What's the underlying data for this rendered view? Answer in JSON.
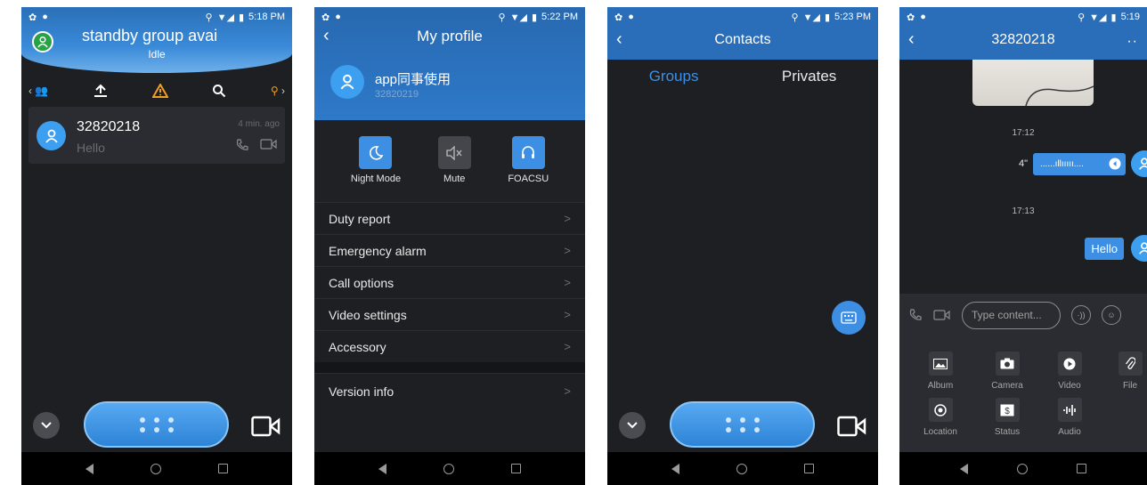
{
  "status_bar": {
    "p1_time": "5:18 PM",
    "p2_time": "5:22 PM",
    "p3_time": "5:23 PM",
    "p4_time": "5:19"
  },
  "standby_screen": {
    "title": "standby group avai",
    "subtitle": "Idle",
    "contact": {
      "name": "32820218",
      "last_message": "Hello",
      "time": "4 min. ago"
    }
  },
  "profile_screen": {
    "title": "My profile",
    "user_name": "app同事使用",
    "user_id": "32820219",
    "quick_actions": [
      {
        "label": "Night Mode"
      },
      {
        "label": "Mute"
      },
      {
        "label": "FOACSU"
      }
    ],
    "menu": [
      {
        "label": "Duty report",
        "chevron": ">"
      },
      {
        "label": "Emergency alarm",
        "chevron": ">"
      },
      {
        "label": "Call options",
        "chevron": ">"
      },
      {
        "label": "Video settings",
        "chevron": ">"
      },
      {
        "label": "Accessory",
        "chevron": ">"
      }
    ],
    "version_item": {
      "label": "Version info",
      "chevron": ">"
    }
  },
  "contacts_screen": {
    "title": "Contacts",
    "tabs": [
      "Groups",
      "Privates"
    ]
  },
  "chat_screen": {
    "title": "32820218",
    "more": "··",
    "timestamps": [
      "17:12",
      "17:13"
    ],
    "voice_duration": "4\"",
    "voice_wave": "......ıllııııı....",
    "text_message": "Hello",
    "input_placeholder": "Type content...",
    "attachments": [
      "Album",
      "Camera",
      "Video",
      "File",
      "Location",
      "Status",
      "Audio"
    ]
  },
  "colors": {
    "accent_blue": "#3d8fe4",
    "header_blue": "#2a6db8",
    "background": "#1e1f23",
    "alert_orange": "#f0a020"
  }
}
